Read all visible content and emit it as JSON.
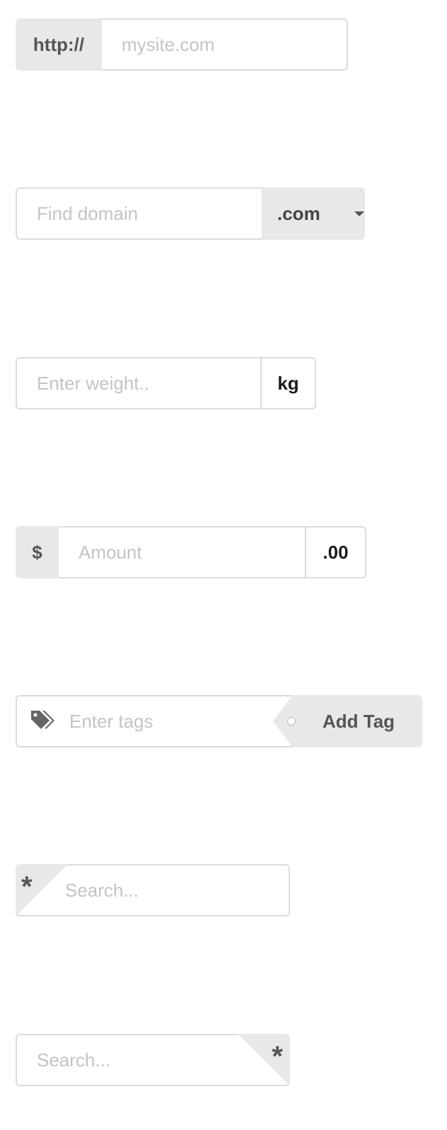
{
  "url_input": {
    "prefix_label": "http://",
    "placeholder": "mysite.com"
  },
  "domain_input": {
    "placeholder": "Find domain",
    "dropdown_value": ".com"
  },
  "weight_input": {
    "placeholder": "Enter weight..",
    "unit_label": "kg"
  },
  "amount_input": {
    "prefix_label": "$",
    "placeholder": "Amount",
    "suffix_label": ".00"
  },
  "tags_input": {
    "icon": "tags-icon",
    "placeholder": "Enter tags",
    "button_label": "Add Tag"
  },
  "search_left_corner": {
    "corner_label": "*",
    "placeholder": "Search..."
  },
  "search_right_corner": {
    "corner_label": "*",
    "placeholder": "Search..."
  }
}
